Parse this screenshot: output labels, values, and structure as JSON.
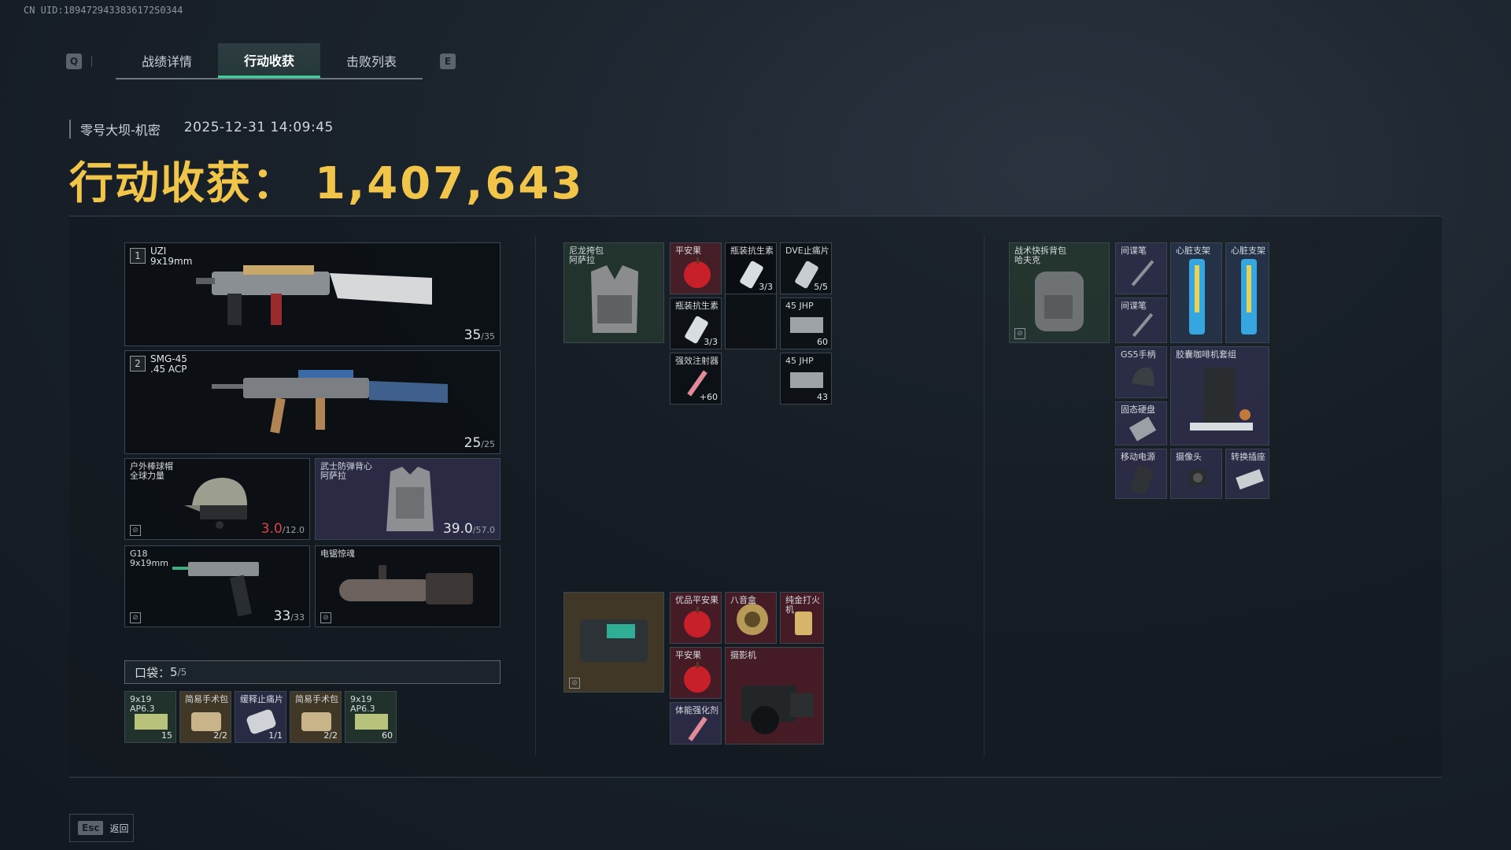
{
  "uid": "CN UID:1894729433836172S0344",
  "tabs": {
    "key_left": "Q",
    "key_right": "E",
    "items": [
      "战绩详情",
      "行动收获",
      "击败列表"
    ],
    "active": 1
  },
  "meta": {
    "map": "零号大坝-机密",
    "time": "2025-12-31 14:09:45"
  },
  "headline": {
    "label": "行动收获：",
    "value": "1,407,643"
  },
  "loadout": {
    "weapon1": {
      "index": "1",
      "name": "UZI",
      "caliber": "9x19mm",
      "ammo": "35",
      "ammo_max": "/35"
    },
    "weapon2": {
      "index": "2",
      "name": "SMG-45",
      "caliber": ".45 ACP",
      "ammo": "25",
      "ammo_max": "/25"
    },
    "helmet": {
      "name": "户外棒球帽",
      "sub": "全球力量",
      "dur": "3.0",
      "dur_max": "/12.0"
    },
    "armor": {
      "name": "武士防弹背心",
      "sub": "阿萨拉",
      "dur": "39.0",
      "dur_max": "/57.0"
    },
    "pistol": {
      "name": "G18",
      "caliber": "9x19mm",
      "ammo": "33",
      "ammo_max": "/33"
    },
    "melee": {
      "name": "电锯惊魂"
    }
  },
  "pocket": {
    "label": "口袋：",
    "count": "5",
    "count_max": "/5",
    "items": [
      {
        "name": "9x19 AP6.3",
        "count": "15"
      },
      {
        "name": "简易手术包",
        "count": "2/2"
      },
      {
        "name": "缓释止痛片",
        "count": "1/1"
      },
      {
        "name": "简易手术包",
        "count": "2/2"
      },
      {
        "name": "9x19 AP6.3",
        "count": "60"
      }
    ]
  },
  "chest_rig": {
    "name": "尼龙挎包",
    "sub": "阿萨拉",
    "items": [
      {
        "name": "平安果",
        "count": ""
      },
      {
        "name": "瓶装抗生素",
        "count": "3/3"
      },
      {
        "name": "DVE止痛片",
        "count": "5/5"
      },
      {
        "name": "瓶装抗生素",
        "count": "3/3"
      },
      {
        "name": "45 JHP",
        "count": "60"
      },
      {
        "name": "强效注射器",
        "count": "+60"
      },
      {
        "name": "45 JHP",
        "count": "43"
      }
    ]
  },
  "backpack": {
    "name": "战术快拆背包",
    "sub": "哈夫克",
    "items": [
      {
        "name": "间谍笔"
      },
      {
        "name": "心脏支架"
      },
      {
        "name": "心脏支架"
      },
      {
        "name": "间谍笔"
      },
      {
        "name": "GS5手柄"
      },
      {
        "name": "胶囊咖啡机套组"
      },
      {
        "name": "固态硬盘"
      },
      {
        "name": "移动电源"
      },
      {
        "name": "摄像头"
      },
      {
        "name": "转换插座"
      }
    ]
  },
  "safebox": {
    "items": [
      {
        "name": "优品平安果"
      },
      {
        "name": "八音盒"
      },
      {
        "name": "纯金打火机"
      },
      {
        "name": "平安果"
      },
      {
        "name": "摄影机"
      },
      {
        "name": "体能强化剂"
      }
    ]
  },
  "footer": {
    "key": "Esc",
    "label": "返回"
  },
  "colors": {
    "accent": "#3ed09a",
    "gold": "#f0c54a",
    "danger": "#e0424a"
  }
}
